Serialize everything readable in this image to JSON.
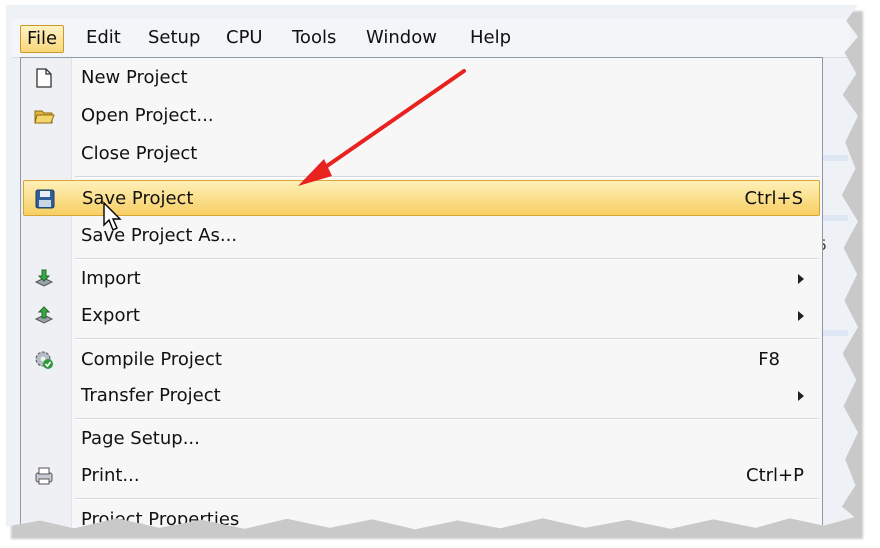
{
  "menubar": {
    "items": [
      "File",
      "Edit",
      "Setup",
      "CPU",
      "Tools",
      "Window",
      "Help"
    ],
    "active": "File"
  },
  "file_menu": {
    "items": [
      {
        "label": "New Project",
        "icon": "new-document-icon"
      },
      {
        "label": "Open Project...",
        "icon": "open-folder-icon"
      },
      {
        "label": "Close Project"
      },
      {
        "label": "Save Project",
        "shortcut": "Ctrl+S",
        "icon": "save-disk-icon",
        "highlighted": true
      },
      {
        "label": "Save Project As..."
      },
      {
        "label": "Import",
        "submenu": true,
        "icon": "import-icon"
      },
      {
        "label": "Export",
        "submenu": true,
        "icon": "export-icon"
      },
      {
        "label": "Compile Project",
        "shortcut": "F8",
        "icon": "compile-gear-icon"
      },
      {
        "label": "Transfer Project",
        "submenu": true
      },
      {
        "label": "Page Setup..."
      },
      {
        "label": "Print...",
        "shortcut": "Ctrl+P",
        "icon": "printer-icon"
      },
      {
        "label": "Project Properties"
      }
    ]
  },
  "background": {
    "fragment_text": "5"
  },
  "annotation": {
    "arrow_color": "#e8221f"
  },
  "colors": {
    "highlight": "#f7cf63",
    "menu_bg": "#f7f7f7"
  }
}
